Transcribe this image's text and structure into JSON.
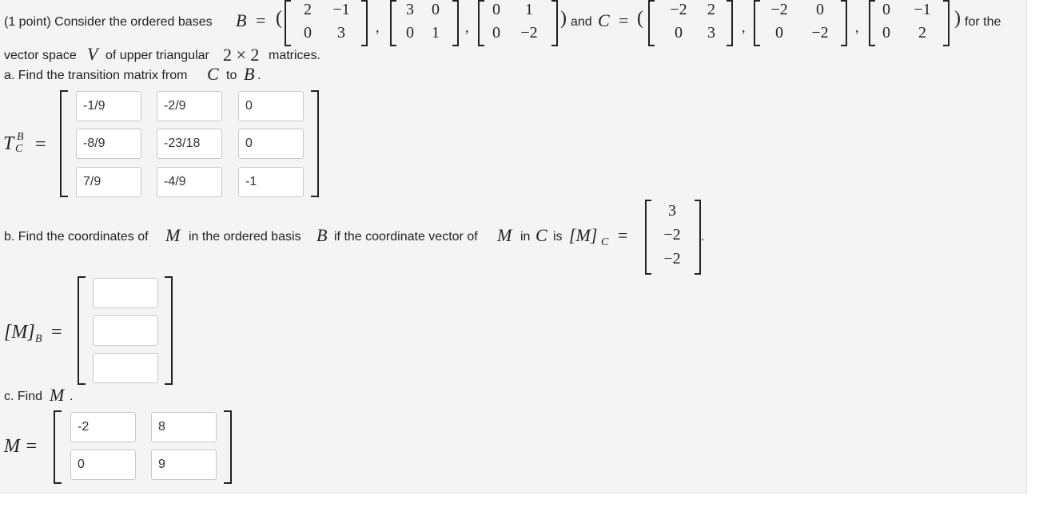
{
  "intro": {
    "prefix": "(1 point) Consider the ordered bases",
    "B_label": "B",
    "equals": "=",
    "and": "and",
    "C_label": "C",
    "for_the": "for the",
    "line2": "vector space",
    "V_label": "V",
    "line2_rest": "of upper triangular",
    "dims": "2 × 2",
    "matrices": "matrices."
  },
  "basis_B": [
    [
      [
        "2",
        "−1"
      ],
      [
        "0",
        "3"
      ]
    ],
    [
      [
        "3",
        "0"
      ],
      [
        "0",
        "1"
      ]
    ],
    [
      [
        "0",
        "1"
      ],
      [
        "0",
        "−2"
      ]
    ]
  ],
  "basis_C": [
    [
      [
        "−2",
        "2"
      ],
      [
        "0",
        "3"
      ]
    ],
    [
      [
        "−2",
        "0"
      ],
      [
        "0",
        "−2"
      ]
    ],
    [
      [
        "0",
        "−1"
      ],
      [
        "0",
        "2"
      ]
    ]
  ],
  "part_a": {
    "prompt_pre": "a. Find the transition matrix from",
    "from": "C",
    "to_word": "to",
    "to": "B",
    "period": ".",
    "label_T": "T",
    "label_sup": "B",
    "label_sub": "C",
    "label_eq": "=",
    "values": [
      [
        "-1/9",
        "-2/9",
        "0"
      ],
      [
        "-8/9",
        "-23/18",
        "0"
      ],
      [
        "7/9",
        "-4/9",
        "-1"
      ]
    ]
  },
  "part_b": {
    "prompt_pre": "b. Find the coordinates of",
    "M": "M",
    "in_basis": "in the ordered basis",
    "B": "B",
    "if_text": "if the coordinate vector of",
    "in_word": "in",
    "C": "C",
    "is_word": "is",
    "coord_label": "[M]",
    "coord_sub": "C",
    "eq": "=",
    "vector": [
      "3",
      "−2",
      "−2"
    ],
    "answer_label": "[M]",
    "answer_sub": "B",
    "answer_values": [
      "",
      "",
      ""
    ]
  },
  "part_c": {
    "prompt": "c. Find",
    "M": "M",
    "period": ".",
    "label": "M =",
    "values": [
      [
        "-2",
        "8"
      ],
      [
        "0",
        "9"
      ]
    ]
  }
}
